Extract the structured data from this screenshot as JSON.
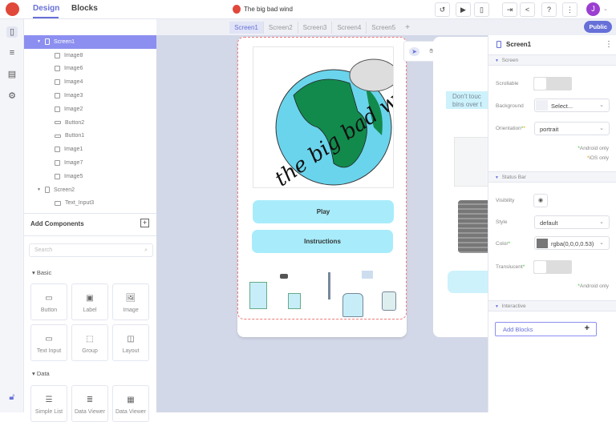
{
  "header": {
    "tabs": [
      "Design",
      "Blocks"
    ],
    "active_tab": "Design",
    "project_title": "The big bad wind",
    "avatar_letter": "J",
    "accent": "#6670d8"
  },
  "screen_tabs": {
    "items": [
      "Screen1",
      "Screen2",
      "Screen3",
      "Screen4",
      "Screen5"
    ],
    "active": "Screen1",
    "add": "+",
    "public_label": "Public"
  },
  "tree": {
    "screen1": "Screen1",
    "children": [
      "Image8",
      "Image6",
      "Image4",
      "Image3",
      "Image2",
      "Button2",
      "Button1",
      "Image1",
      "Image7",
      "Image5"
    ],
    "child_types": [
      "image",
      "image",
      "image",
      "image",
      "image",
      "button",
      "button",
      "image",
      "image",
      "image"
    ],
    "screen2": "Screen2",
    "screen2_children": [
      "Text_Input3"
    ]
  },
  "components": {
    "title": "Add Components",
    "search_placeholder": "Search",
    "basic_label": "Basic",
    "basic": [
      "Button",
      "Label",
      "Image",
      "Text Input",
      "Group",
      "Layout"
    ],
    "data_label": "Data",
    "data": [
      "Simple List",
      "Data Viewer",
      "Data Viewer"
    ]
  },
  "phone1": {
    "buttons": [
      "Play",
      "Instructions"
    ],
    "logo_text": "the big bad wind"
  },
  "phone2": {
    "label_text": "Don't touc bins over t"
  },
  "props": {
    "title": "Screen1",
    "screen_section": "Screen",
    "scrollable": "Scrollable",
    "background": "Background",
    "background_value": "Select...",
    "orientation": "Orientation",
    "orientation_value": "portrait",
    "android_only": "Android only",
    "ios_only": "iOS only",
    "status_section": "Status Bar",
    "visibility": "Visibility",
    "style": "Style",
    "style_value": "default",
    "color": "Color",
    "color_value": "rgba(0,0,0,0.53)",
    "translucent": "Translucent",
    "android_only2": "Android only",
    "interactive_section": "Interactive",
    "add_blocks": "Add Blocks"
  }
}
